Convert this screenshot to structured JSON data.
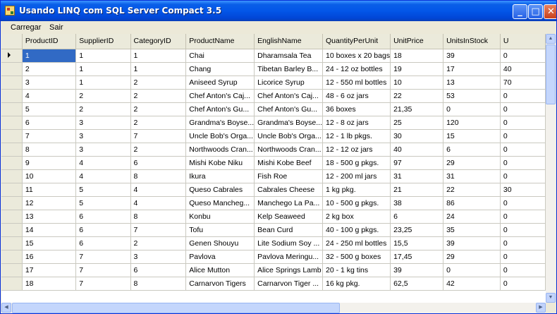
{
  "window": {
    "title": "Usando LINQ com SQL Server Compact 3.5"
  },
  "titlebar_buttons": {
    "minimize": "_",
    "maximize": "□",
    "close": "✕"
  },
  "menu": [
    {
      "label": "Carregar"
    },
    {
      "label": "Sair"
    }
  ],
  "grid": {
    "columns": [
      "ProductID",
      "SupplierID",
      "CategoryID",
      "ProductName",
      "EnglishName",
      "QuantityPerUnit",
      "UnitPrice",
      "UnitsInStock",
      "U"
    ],
    "selected_row": 0,
    "rows": [
      [
        "1",
        "1",
        "1",
        "Chai",
        "Dharamsala Tea",
        "10 boxes x 20 bags",
        "18",
        "39",
        "0"
      ],
      [
        "2",
        "1",
        "1",
        "Chang",
        "Tibetan Barley B...",
        "24 - 12 oz bottles",
        "19",
        "17",
        "40"
      ],
      [
        "3",
        "1",
        "2",
        "Aniseed Syrup",
        "Licorice Syrup",
        "12 - 550 ml bottles",
        "10",
        "13",
        "70"
      ],
      [
        "4",
        "2",
        "2",
        "Chef Anton's Caj...",
        "Chef Anton's Caj...",
        "48 - 6 oz jars",
        "22",
        "53",
        "0"
      ],
      [
        "5",
        "2",
        "2",
        "Chef Anton's Gu...",
        "Chef Anton's Gu...",
        "36 boxes",
        "21,35",
        "0",
        "0"
      ],
      [
        "6",
        "3",
        "2",
        "Grandma's Boyse...",
        "Grandma's Boyse...",
        "12 - 8 oz jars",
        "25",
        "120",
        "0"
      ],
      [
        "7",
        "3",
        "7",
        "Uncle Bob's Orga...",
        "Uncle Bob's Orga...",
        "12 - 1 lb pkgs.",
        "30",
        "15",
        "0"
      ],
      [
        "8",
        "3",
        "2",
        "Northwoods Cran...",
        "Northwoods Cran...",
        "12 - 12 oz jars",
        "40",
        "6",
        "0"
      ],
      [
        "9",
        "4",
        "6",
        "Mishi Kobe Niku",
        "Mishi Kobe Beef",
        "18 - 500 g pkgs.",
        "97",
        "29",
        "0"
      ],
      [
        "10",
        "4",
        "8",
        "Ikura",
        "Fish Roe",
        "12 - 200 ml jars",
        "31",
        "31",
        "0"
      ],
      [
        "11",
        "5",
        "4",
        "Queso Cabrales",
        "Cabrales Cheese",
        "1 kg pkg.",
        "21",
        "22",
        "30"
      ],
      [
        "12",
        "5",
        "4",
        "Queso Mancheg...",
        "Manchego La Pa...",
        "10 - 500 g pkgs.",
        "38",
        "86",
        "0"
      ],
      [
        "13",
        "6",
        "8",
        "Konbu",
        "Kelp Seaweed",
        "2 kg box",
        "6",
        "24",
        "0"
      ],
      [
        "14",
        "6",
        "7",
        "Tofu",
        "Bean Curd",
        "40 - 100 g pkgs.",
        "23,25",
        "35",
        "0"
      ],
      [
        "15",
        "6",
        "2",
        "Genen Shouyu",
        "Lite Sodium Soy ...",
        "24 - 250 ml bottles",
        "15,5",
        "39",
        "0"
      ],
      [
        "16",
        "7",
        "3",
        "Pavlova",
        "Pavlova Meringu...",
        "32 - 500 g boxes",
        "17,45",
        "29",
        "0"
      ],
      [
        "17",
        "7",
        "6",
        "Alice Mutton",
        "Alice Springs Lamb",
        "20 - 1 kg tins",
        "39",
        "0",
        "0"
      ],
      [
        "18",
        "7",
        "8",
        "Carnarvon Tigers",
        "Carnarvon Tiger ...",
        "16 kg pkg.",
        "62,5",
        "42",
        "0"
      ]
    ]
  }
}
